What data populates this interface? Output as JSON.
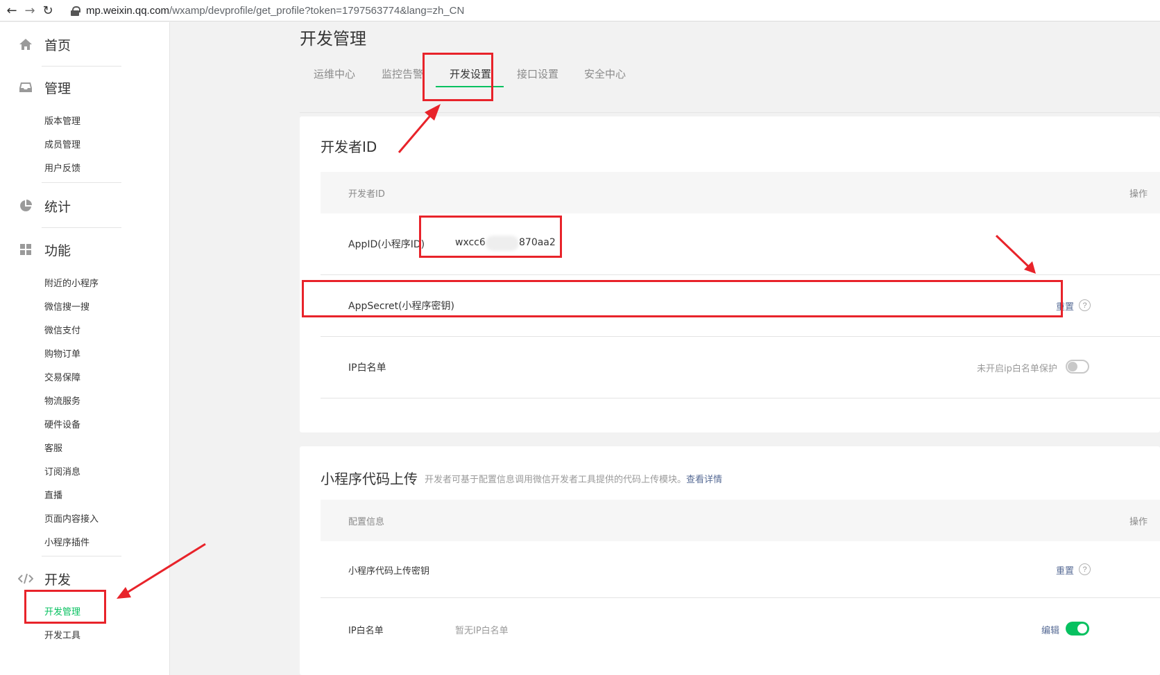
{
  "browser": {
    "url_host": "mp.weixin.qq.com",
    "url_path": "/wxamp/devprofile/get_profile?token=1797563774&lang=zh_CN"
  },
  "sidebar": {
    "home": "首页",
    "manage": {
      "label": "管理",
      "items": [
        "版本管理",
        "成员管理",
        "用户反馈"
      ]
    },
    "stats": "统计",
    "features": {
      "label": "功能",
      "items": [
        "附近的小程序",
        "微信搜一搜",
        "微信支付",
        "购物订单",
        "交易保障",
        "物流服务",
        "硬件设备",
        "客服",
        "订阅消息",
        "直播",
        "页面内容接入",
        "小程序插件"
      ]
    },
    "dev": {
      "label": "开发",
      "items": [
        "开发管理",
        "开发工具"
      ]
    }
  },
  "page_title": "开发管理",
  "tabs": [
    "运维中心",
    "监控告警",
    "开发设置",
    "接口设置",
    "安全中心"
  ],
  "developer_id_card": {
    "title": "开发者ID",
    "col_left": "开发者ID",
    "col_right": "操作",
    "appid_label": "AppID(小程序ID)",
    "appid_prefix": "wxcc6",
    "appid_suffix": "870aa2",
    "appsecret_label": "AppSecret(小程序密钥)",
    "reset": "重置",
    "help": "?",
    "ip_label": "IP白名单",
    "ip_status": "未开启ip白名单保护"
  },
  "upload_card": {
    "title": "小程序代码上传",
    "subtitle": "开发者可基于配置信息调用微信开发者工具提供的代码上传模块。",
    "subtitle_link": "查看详情",
    "col_left": "配置信息",
    "col_right": "操作",
    "key_label": "小程序代码上传密钥",
    "reset": "重置",
    "help": "?",
    "ip_label": "IP白名单",
    "ip_value": "暂无IP白名单",
    "edit": "编辑"
  },
  "colors": {
    "accent_green": "#07c160",
    "link_blue": "#576b95",
    "annotation_red": "#e8232a"
  }
}
